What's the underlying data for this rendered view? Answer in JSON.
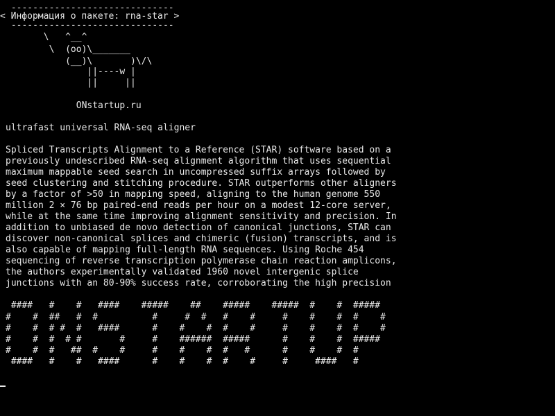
{
  "cowsay": {
    "top_border": " ------------------------------",
    "message": "< Информация о пакете: rna-star >",
    "bottom_border": " ------------------------------",
    "cow": [
      "       \\   ^__^",
      "        \\  (oo)\\_______",
      "           (__)\\       )\\/\\",
      "               ||----w |",
      "               ||     ||"
    ]
  },
  "site_label": "             ONstartup.ru",
  "package": {
    "summary": "ultrafast universal RNA-seq aligner",
    "description_lines": [
      "Spliced Transcripts Alignment to a Reference (STAR) software based on a",
      "previously undescribed RNA-seq alignment algorithm that uses sequential",
      "maximum mappable seed search in uncompressed suffix arrays followed by",
      "seed clustering and stitching procedure. STAR outperforms other aligners",
      "by a factor of >50 in mapping speed, aligning to the human genome 550",
      "million 2 × 76 bp paired-end reads per hour on a modest 12-core server,",
      "while at the same time improving alignment sensitivity and precision. In",
      "addition to unbiased de novo detection of canonical junctions, STAR can",
      "discover non-canonical splices and chimeric (fusion) transcripts, and is",
      "also capable of mapping full-length RNA sequences. Using Roche 454",
      "sequencing of reverse transcription polymerase chain reaction amplicons,",
      "the authors experimentally validated 1960 novel intergenic splice",
      "junctions with an 80-90% success rate, corroborating the high precision"
    ]
  },
  "banner_lines": [
    " ####   #    #   ####    #####    ##    #####    #####  #    #  #####",
    "#    #  ##   #  #          #     #  #   #    #     #    #    #  #    #",
    "#    #  # #  #   ####      #    #    #  #    #     #    #    #  #    #",
    "#    #  #  # #       #     #    ######  #####      #    #    #  #####",
    "#    #  #   ##  #    #     #    #    #  #   #      #    #    #  #",
    " ####   #    #   ####      #    #    #  #    #     #     ####   #"
  ]
}
